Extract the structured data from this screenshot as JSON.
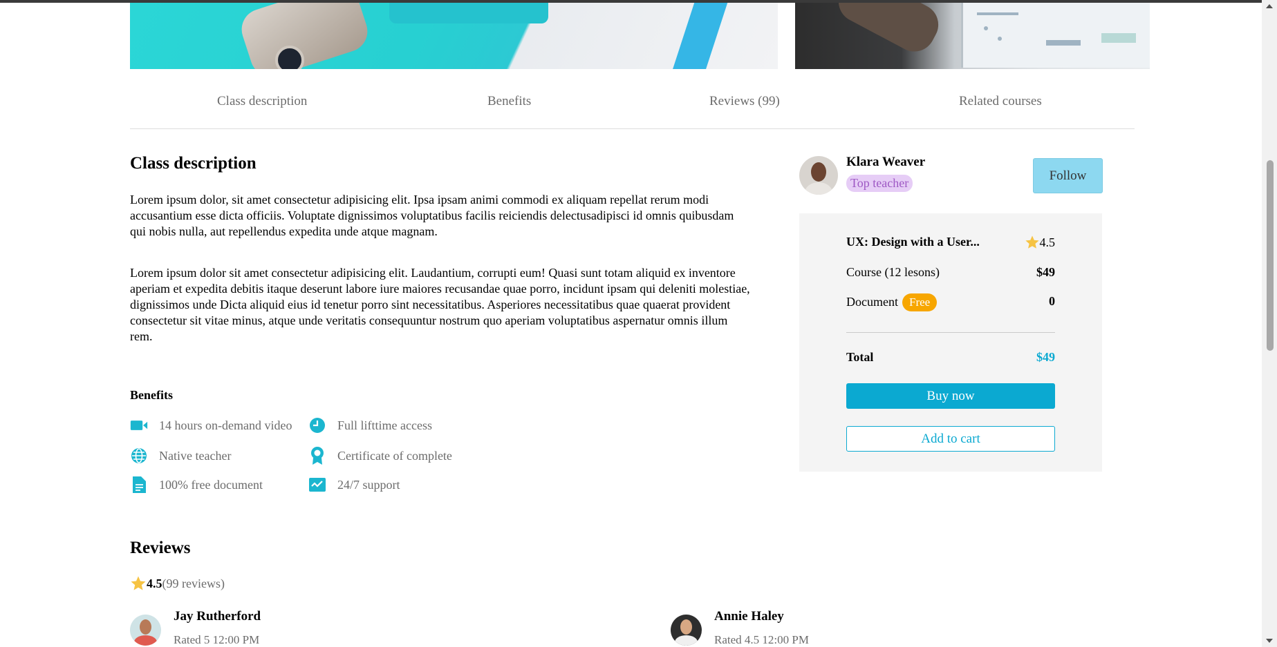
{
  "tabs": [
    "Class description",
    "Benefits",
    "Reviews (99)",
    "Related courses"
  ],
  "description": {
    "title": "Class description",
    "paragraphs": [
      "Lorem ipsum dolor, sit amet consectetur adipisicing elit. Ipsa ipsam animi commodi ex aliquam repellat rerum modi accusantium esse dicta officiis. Voluptate dignissimos voluptatibus facilis reiciendis delectusadipisci id omnis quibusdam qui nobis nulla, aut repellendus expedita unde atque magnam.",
      "Lorem ipsum dolor sit amet consectetur adipisicing elit. Laudantium, corrupti eum! Quasi sunt totam aliquid ex inventore aperiam et expedita debitis itaque deserunt labore iure maiores recusandae quae porro, incidunt ipsam qui deleniti molestiae, dignissimos unde Dicta aliquid eius id tenetur porro sint necessitatibus. Asperiores necessitatibus quae quaerat provident consectetur sit vitae minus, atque unde veritatis consequuntur nostrum quo aperiam voluptatibus aspernatur omnis illum rem."
    ]
  },
  "benefits": {
    "title": "Benefits",
    "items": [
      {
        "label": "14 hours on-demand video",
        "icon": "video-camera-icon"
      },
      {
        "label": "Full lifttime access",
        "icon": "clock-icon"
      },
      {
        "label": "Native teacher",
        "icon": "globe-icon"
      },
      {
        "label": "Certificate of complete",
        "icon": "award-icon"
      },
      {
        "label": "100% free document",
        "icon": "document-icon"
      },
      {
        "label": "24/7 support",
        "icon": "chart-check-icon"
      }
    ]
  },
  "teacher": {
    "name": "Klara Weaver",
    "badge": "Top teacher",
    "follow_label": "Follow"
  },
  "purchase": {
    "course_title": "UX: Design with a User...",
    "rating": "4.5",
    "course_label": "Course (12 lesons)",
    "course_price": "$49",
    "document_label": "Document",
    "free_badge": "Free",
    "document_price": "0",
    "total_label": "Total",
    "total_price": "$49",
    "buy_label": "Buy now",
    "cart_label": "Add to cart"
  },
  "reviews": {
    "title": "Reviews",
    "rating": "4.5",
    "count": "(99 reviews)",
    "items": [
      {
        "name": "Jay Rutherford",
        "meta": "Rated 5 12:00 PM"
      },
      {
        "name": "Annie Haley",
        "meta": "Rated 4.5 12:00 PM"
      }
    ]
  },
  "colors": {
    "accent": "#0ba9d1",
    "follow_bg": "#8dd8f0",
    "badge_bg": "#e6cdf6",
    "badge_text": "#9e58c4",
    "free_bg": "#f7a600",
    "star": "#f6c343",
    "benefit_icon": "#1bb6cf"
  }
}
